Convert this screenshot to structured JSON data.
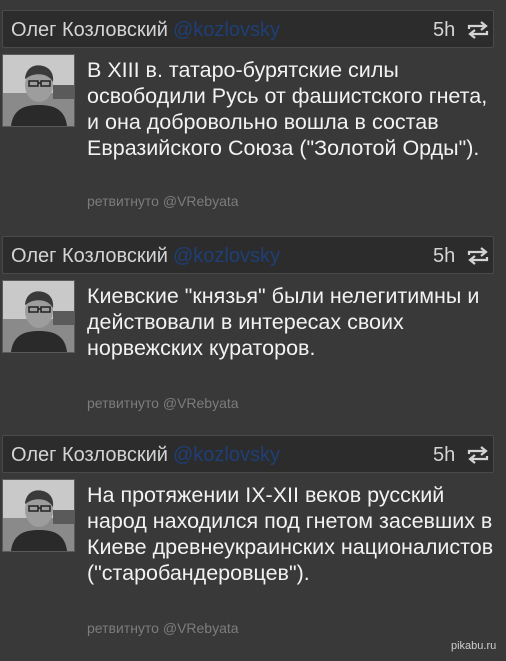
{
  "tweets": [
    {
      "author": "Олег Козловский",
      "handle": "@kozlovsky",
      "time": "5h",
      "text": "В XIII в. татаро-бурятские силы освободили Русь от фашистского гнета, и она добровольно вошла в состав Евразийского Союза (\"Золотой Орды\").",
      "retweeted_by": "ретвитнуто @VRebyata",
      "icons": [
        "avatar",
        "retweet-icon"
      ]
    },
    {
      "author": "Олег Козловский",
      "handle": "@kozlovsky",
      "time": "5h",
      "text": "Киевские \"князья\" были нелегитимны и действовали в интересах своих норвежских кураторов.",
      "retweeted_by": "ретвитнуто @VRebyata",
      "icons": [
        "avatar",
        "retweet-icon"
      ]
    },
    {
      "author": "Олег Козловский",
      "handle": "@kozlovsky",
      "time": "5h",
      "text": "На протяжении IX-XII веков русский народ находился под гнетом засевших в Киеве древнеукраинских националистов (\"старобандеровцев\").",
      "retweeted_by": "ретвитнуто @VRebyata",
      "icons": [
        "avatar",
        "retweet-icon"
      ]
    }
  ],
  "watermark": "pikabu.ru",
  "colors": {
    "background": "#393939",
    "header_bg": "#2c2c2c",
    "handle": "#1e3f77",
    "text": "#f2f2f2",
    "muted": "#7c7c7c"
  }
}
